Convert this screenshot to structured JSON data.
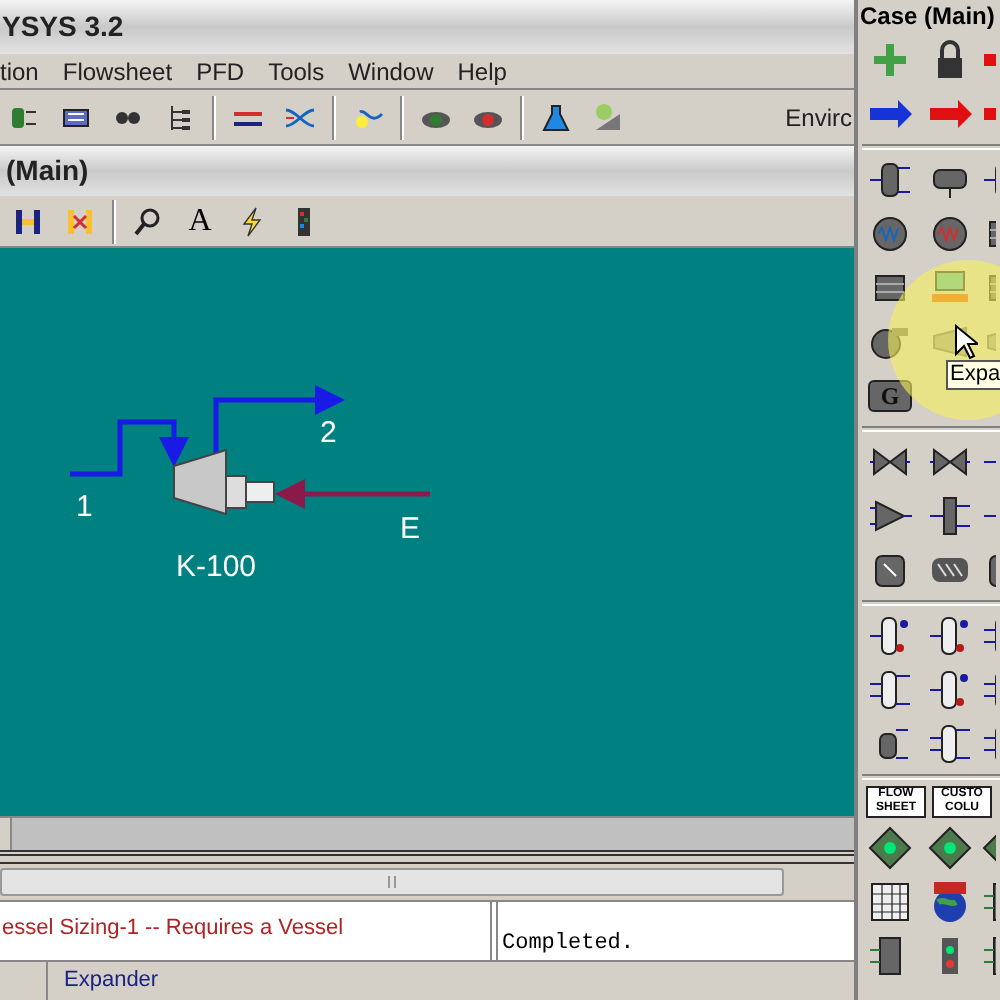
{
  "window": {
    "title": "YSYS 3.2"
  },
  "menu": [
    "tion",
    "Flowsheet",
    "PFD",
    "Tools",
    "Window",
    "Help"
  ],
  "toolbar": {
    "environment_label": "Envirc"
  },
  "pfd": {
    "title": "(Main)",
    "streams": [
      {
        "label": "1",
        "kind": "material"
      },
      {
        "label": "2",
        "kind": "material"
      },
      {
        "label": "E",
        "kind": "energy"
      }
    ],
    "unit": {
      "label": "K-100"
    },
    "text_tool": "A"
  },
  "messages": {
    "error": "essel Sizing-1 -- Requires a Vessel",
    "trace": "Completed."
  },
  "status_bar": {
    "text": "Expander"
  },
  "palette": {
    "title": "Case (Main)",
    "tooltip": "Expa",
    "generator_mark": "G",
    "text_buttons": [
      "FLOW SHEET",
      "CUSTO COLU"
    ]
  }
}
